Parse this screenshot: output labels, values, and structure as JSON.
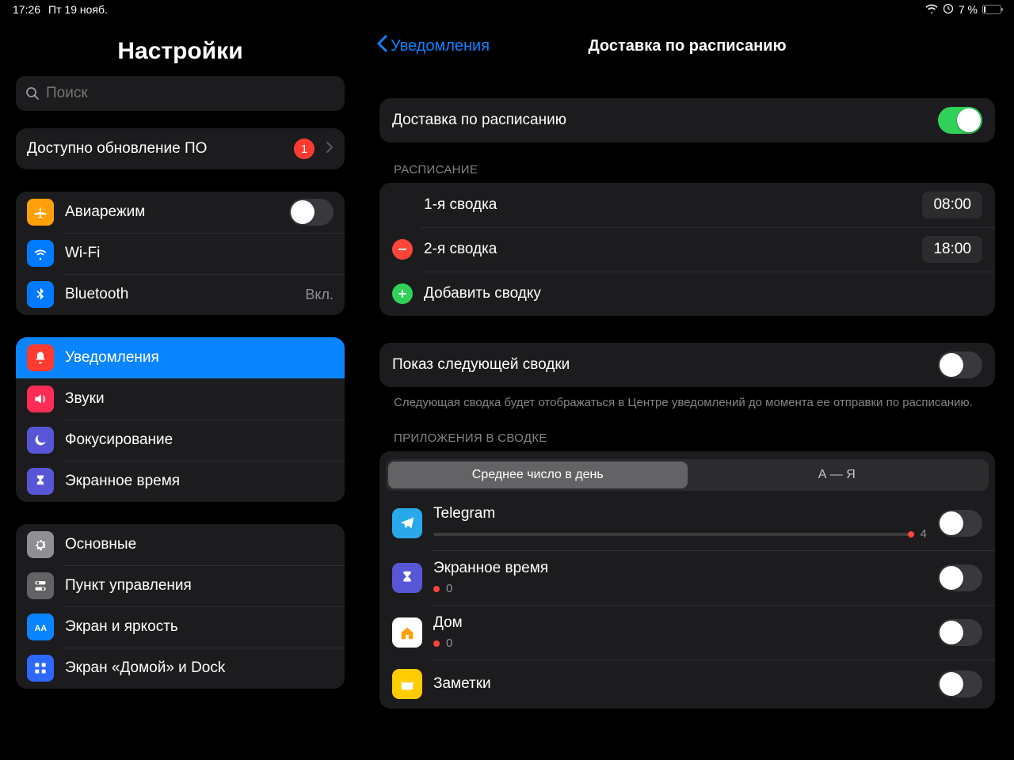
{
  "status": {
    "time": "17:26",
    "date": "Пт 19 нояб.",
    "battery_pct": "7 %"
  },
  "sidebar": {
    "title": "Настройки",
    "search_placeholder": "Поиск",
    "update": {
      "label": "Доступно обновление ПО",
      "badge": "1"
    },
    "group_net": {
      "airplane": "Авиарежим",
      "wifi": "Wi-Fi",
      "bluetooth": "Bluetooth",
      "bluetooth_status": "Вкл."
    },
    "group_notif": {
      "notifications": "Уведомления",
      "sounds": "Звуки",
      "focus": "Фокусирование",
      "screentime": "Экранное время"
    },
    "group_gen": {
      "general": "Основные",
      "control": "Пункт управления",
      "display": "Экран и яркость",
      "home": "Экран «Домой» и Dock"
    }
  },
  "detail": {
    "back": "Уведомления",
    "title": "Доставка по расписанию",
    "scheduled_delivery": "Доставка по расписанию",
    "sec_schedule": "РАСПИСАНИЕ",
    "summary1": {
      "label": "1-я сводка",
      "time": "08:00"
    },
    "summary2": {
      "label": "2-я сводка",
      "time": "18:00"
    },
    "add_summary": "Добавить сводку",
    "show_next": "Показ следующей сводки",
    "show_next_note": "Следующая сводка будет отображаться в Центре уведомлений до момента ее отправки по расписанию.",
    "sec_apps": "ПРИЛОЖЕНИЯ В СВОДКЕ",
    "seg_avg": "Среднее число в день",
    "seg_az": "А — Я",
    "apps": {
      "telegram": {
        "name": "Telegram",
        "count": "4"
      },
      "screentime": {
        "name": "Экранное время",
        "count": "0"
      },
      "home": {
        "name": "Дом",
        "count": "0"
      },
      "notes": {
        "name": "Заметки"
      }
    }
  }
}
